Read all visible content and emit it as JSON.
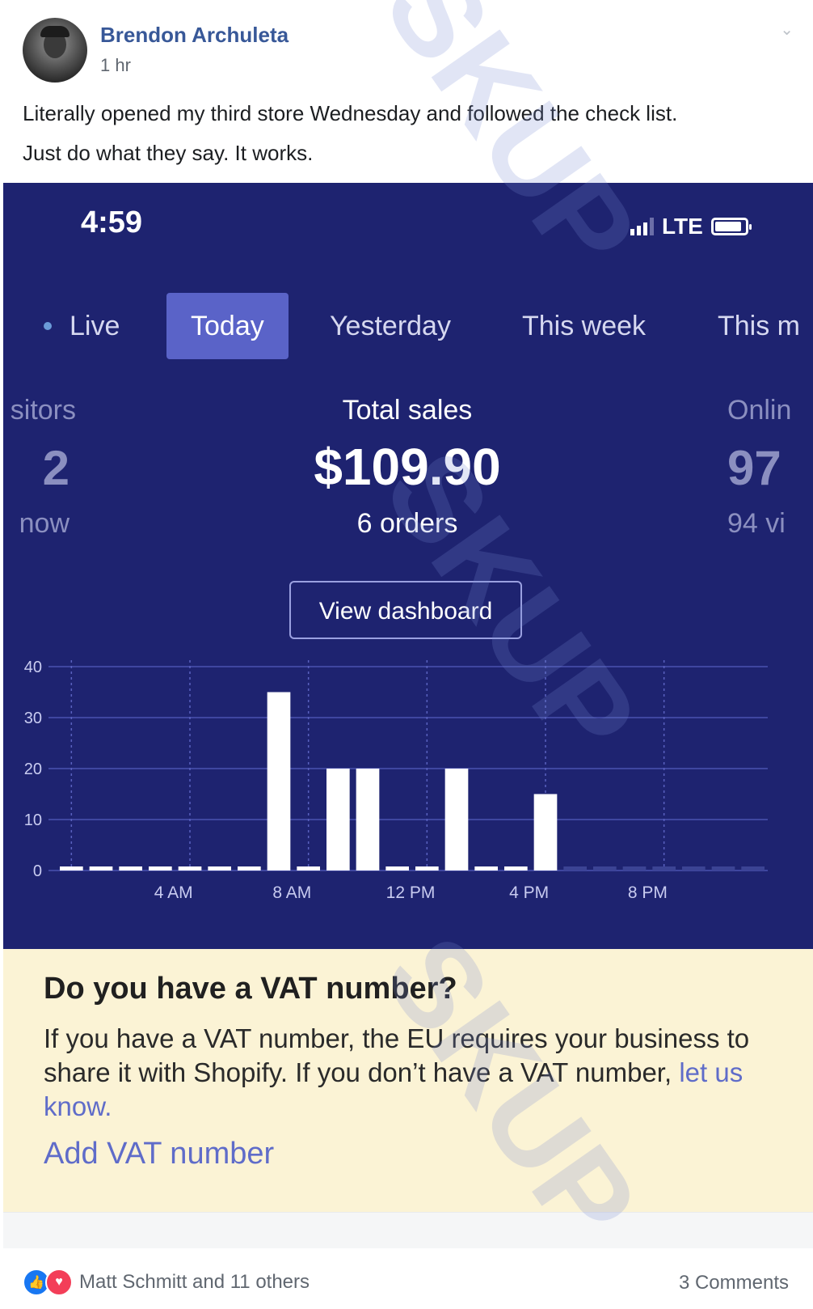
{
  "post": {
    "author": "Brendon Archuleta",
    "time": "1 hr",
    "message_line1": "Literally opened my third store Wednesday and followed the check list.",
    "message_line2": "Just do what they say. It works."
  },
  "phone": {
    "clock": "4:59",
    "network": "LTE",
    "tabs": [
      "Live",
      "Today",
      "Yesterday",
      "This week",
      "This m"
    ],
    "active_tab": "Today",
    "left_metric": {
      "label": "sitors",
      "value": "2",
      "sub": "now"
    },
    "center_metric": {
      "label": "Total sales",
      "value": "$109.90",
      "sub": "6 orders"
    },
    "right_metric": {
      "label": "Onlin",
      "value": "97",
      "sub": "94 vi"
    },
    "dashboard_button": "View dashboard"
  },
  "chart_data": {
    "type": "bar",
    "x_tick_labels": [
      "4 AM",
      "8 AM",
      "12 PM",
      "4 PM",
      "8 PM"
    ],
    "y_tick_labels": [
      "0",
      "10",
      "20",
      "30",
      "40"
    ],
    "ylim": [
      0,
      40
    ],
    "hours": [
      0,
      1,
      2,
      3,
      4,
      5,
      6,
      7,
      8,
      9,
      10,
      11,
      12,
      13,
      14,
      15,
      16,
      17,
      18,
      19,
      20,
      21,
      22,
      23
    ],
    "values": [
      0,
      0,
      0,
      0,
      0,
      0,
      0,
      35,
      0,
      20,
      20,
      0,
      0,
      20,
      0,
      0,
      15,
      0,
      0,
      0,
      0,
      0,
      0,
      0
    ],
    "future_from_hour": 17
  },
  "vat": {
    "title": "Do you have a VAT number?",
    "body": "If you have a VAT number, the EU requires your business to share it with Shopify. If you don’t have a VAT number,",
    "link": "let us know.",
    "action": "Add VAT number"
  },
  "footer": {
    "reactions": "Matt Schmitt and 11 others",
    "comments": "3 Comments"
  }
}
